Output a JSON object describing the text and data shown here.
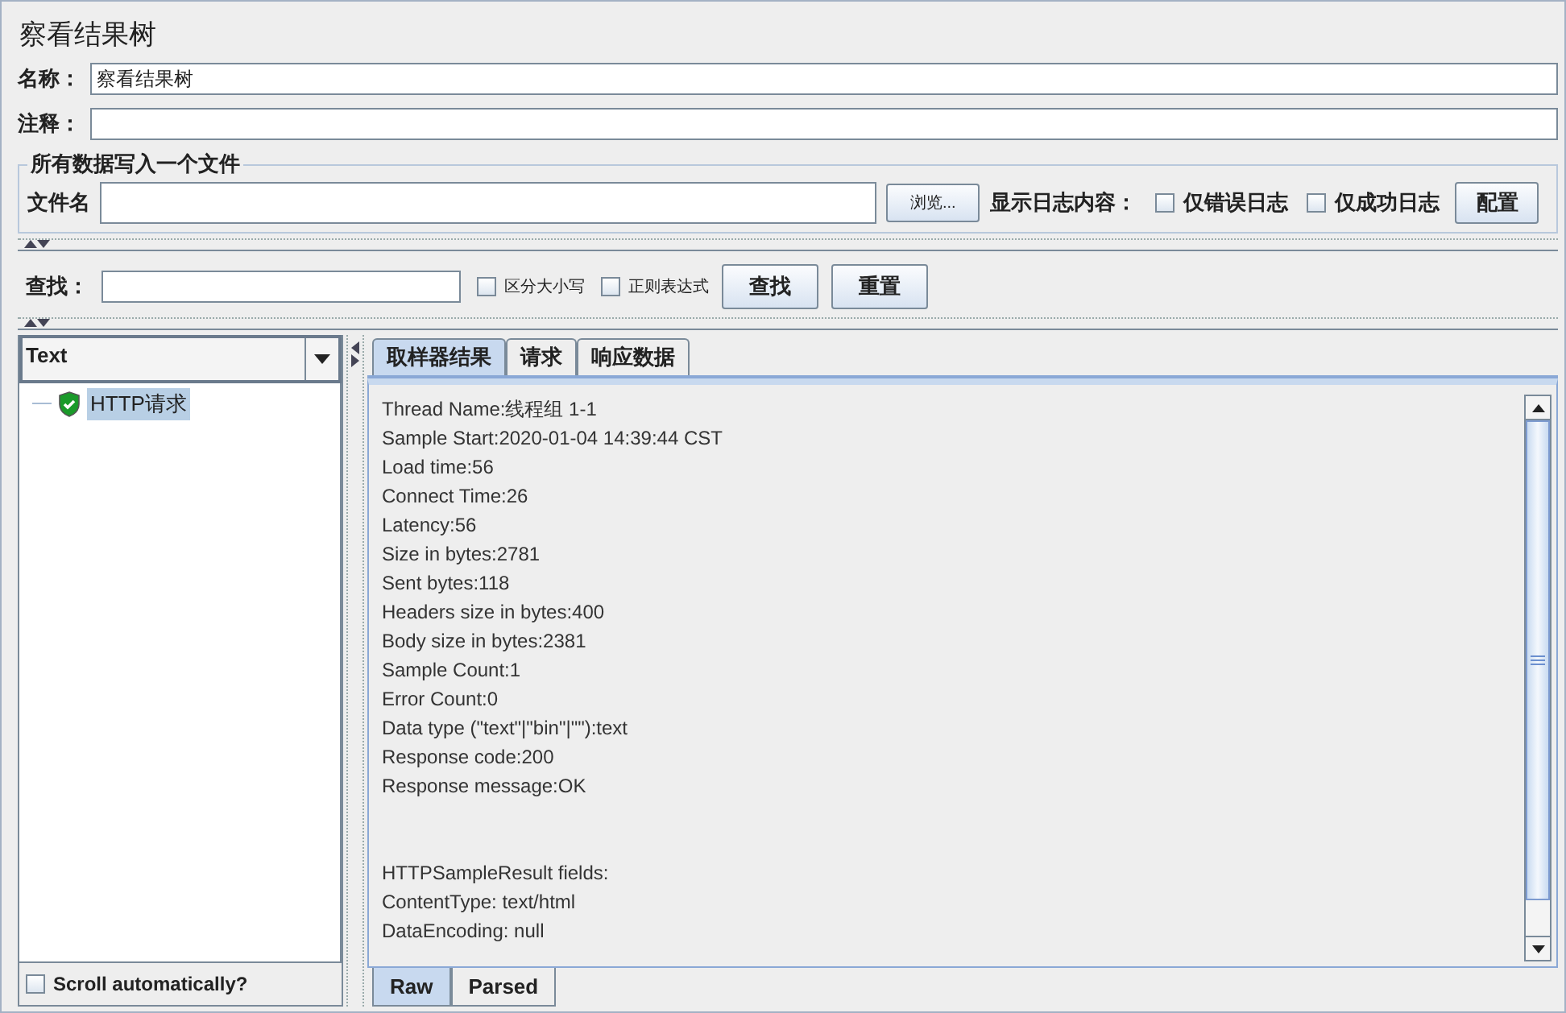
{
  "title": "察看结果树",
  "name_field": {
    "label": "名称：",
    "value": "察看结果树"
  },
  "comment_field": {
    "label": "注释："
  },
  "file_group": {
    "legend": "所有数据写入一个文件",
    "file_label": "文件名",
    "browse_button": "浏览...",
    "log_label": "显示日志内容：",
    "options": [
      {
        "label": "仅错误日志",
        "checked": false
      },
      {
        "label": "仅成功日志",
        "checked": false
      }
    ],
    "configure_button": "配置"
  },
  "search": {
    "label": "查找：",
    "options": [
      {
        "label": "区分大小写",
        "checked": false
      },
      {
        "label": "正则表达式",
        "checked": false
      }
    ],
    "buttons": [
      "查找",
      "重置"
    ]
  },
  "renderer": {
    "value": "Text"
  },
  "tree": [
    {
      "label": "HTTP请求",
      "success": true,
      "selected": true
    }
  ],
  "scroll_auto": {
    "label": "Scroll automatically?",
    "checked": false
  },
  "result_tabs": [
    {
      "label": "取样器结果",
      "selected": true
    },
    {
      "label": "请求",
      "selected": false
    },
    {
      "label": "响应数据",
      "selected": false
    }
  ],
  "sections": [
    {
      "lines": [
        "Thread Name:线程组 1-1",
        "Sample Start:2020-01-04 14:39:44 CST",
        "Load time:56",
        "Connect Time:26",
        "Latency:56",
        "Size in bytes:2781",
        "Sent bytes:118",
        "Headers size in bytes:400",
        "Body size in bytes:2381",
        "Sample Count:1",
        "Error Count:0",
        "Data type (\"text\"|\"bin\"|\"\"):text",
        "Response code:200",
        "Response message:OK"
      ]
    },
    {
      "lines": [
        "HTTPSampleResult fields:",
        "ContentType: text/html",
        "DataEncoding: null"
      ]
    }
  ],
  "view_tabs": [
    {
      "label": "Raw",
      "selected": true
    },
    {
      "label": "Parsed",
      "selected": false
    }
  ]
}
